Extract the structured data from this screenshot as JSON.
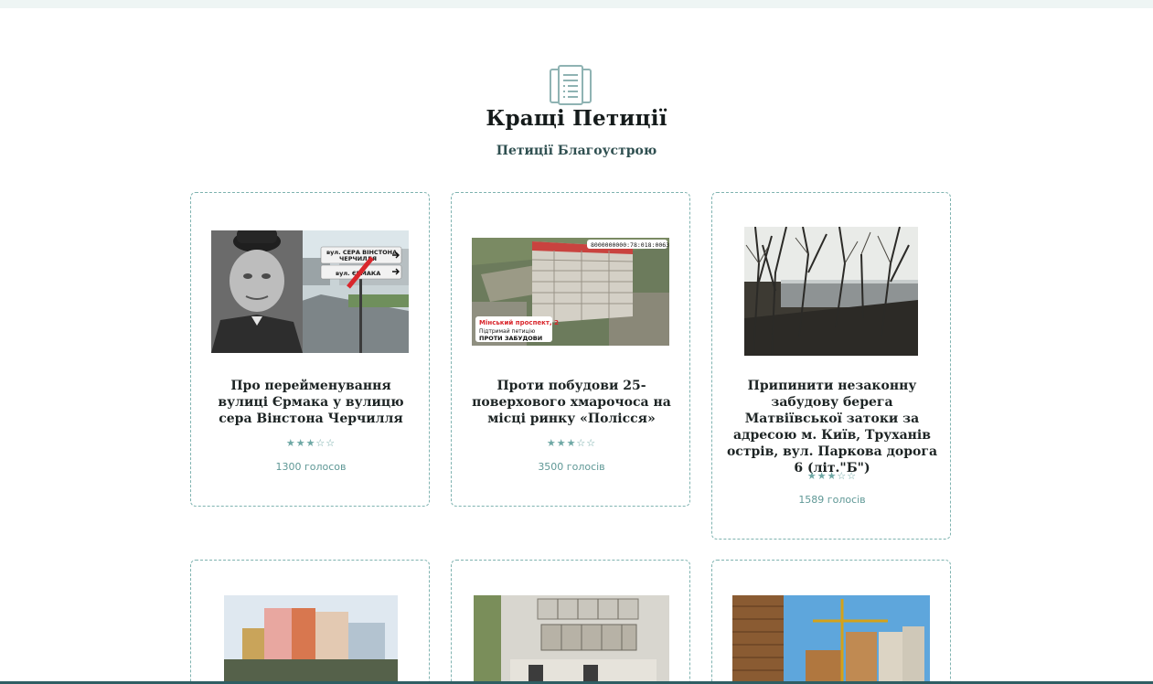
{
  "section": {
    "title": "Кращі Петиції",
    "subtitle": "Петиції Благоустрою",
    "icon": "petition-documents-icon"
  },
  "petitions": [
    {
      "title": "Про перейменування вулиці Єрмака у вулицю сера Вінстона Черчилля",
      "rating": 3,
      "max_rating": 5,
      "votes": "1300 голосов",
      "image": {
        "sign_top": "вул. СЕРА ВІНСТОНА ЧЕРЧИЛЛЯ",
        "sign_bottom": "вул. ЄРМАКА"
      }
    },
    {
      "title": "Проти побудови 25-поверхового хмарочоса на місці ринку «Полісся»",
      "rating": 3,
      "max_rating": 5,
      "votes": "3500 голосів",
      "image": {
        "code": "8000000000:78:018:0063",
        "caption_line1": "Мінський проспект, 2",
        "caption_line2": "Підтримай петицію",
        "caption_line3": "ПРОТИ ЗАБУДОВИ"
      }
    },
    {
      "title": "Припинити незаконну забудову берега Матвіївської затоки за адресою м. Київ, Труханів острів, вул. Паркова дорога 6 (літ.\"Б\")",
      "rating": 3,
      "max_rating": 5,
      "votes": "1589 голосів"
    },
    {
      "title": "",
      "rating": 0,
      "max_rating": 5,
      "votes": ""
    },
    {
      "title": "",
      "rating": 0,
      "max_rating": 5,
      "votes": ""
    },
    {
      "title": "",
      "rating": 0,
      "max_rating": 5,
      "votes": ""
    }
  ],
  "colors": {
    "accent": "#6fa8a5",
    "card_border": "#7fb3b0",
    "footer_bar": "#2f5e63"
  }
}
